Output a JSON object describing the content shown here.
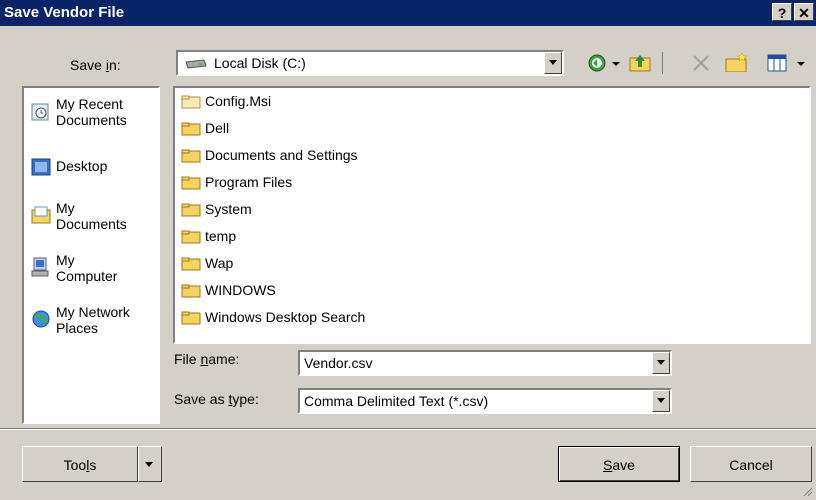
{
  "window": {
    "title": "Save Vendor File",
    "help_btn": "?",
    "close_btn": "✕"
  },
  "save_in": {
    "label_pre": "Save ",
    "label_u": "i",
    "label_post": "n:",
    "value": "Local Disk (C:)"
  },
  "places": [
    {
      "line1": "My Recent",
      "line2": "Documents"
    },
    {
      "line1": "Desktop",
      "line2": ""
    },
    {
      "line1": "My",
      "line2": "Documents"
    },
    {
      "line1": "My",
      "line2": "Computer"
    },
    {
      "line1": "My Network",
      "line2": "Places"
    }
  ],
  "files": [
    "Config.Msi",
    "Dell",
    "Documents and Settings",
    "Program Files",
    "System",
    "temp",
    "Wap",
    "WINDOWS",
    "Windows Desktop Search"
  ],
  "filename": {
    "label_pre": "File ",
    "label_u": "n",
    "label_post": "ame:",
    "value": "Vendor.csv"
  },
  "filetype": {
    "label_pre": "Save as ",
    "label_u": "t",
    "label_post": "ype:",
    "value": "Comma Delimited Text (*.csv)"
  },
  "buttons": {
    "tools_pre": "Too",
    "tools_u": "l",
    "tools_post": "s",
    "save_u": "S",
    "save_post": "ave",
    "cancel": "Cancel"
  },
  "colors": {
    "titlebar": "#0a246a",
    "face": "#d4d0c8",
    "folder": "#f4d35e"
  }
}
